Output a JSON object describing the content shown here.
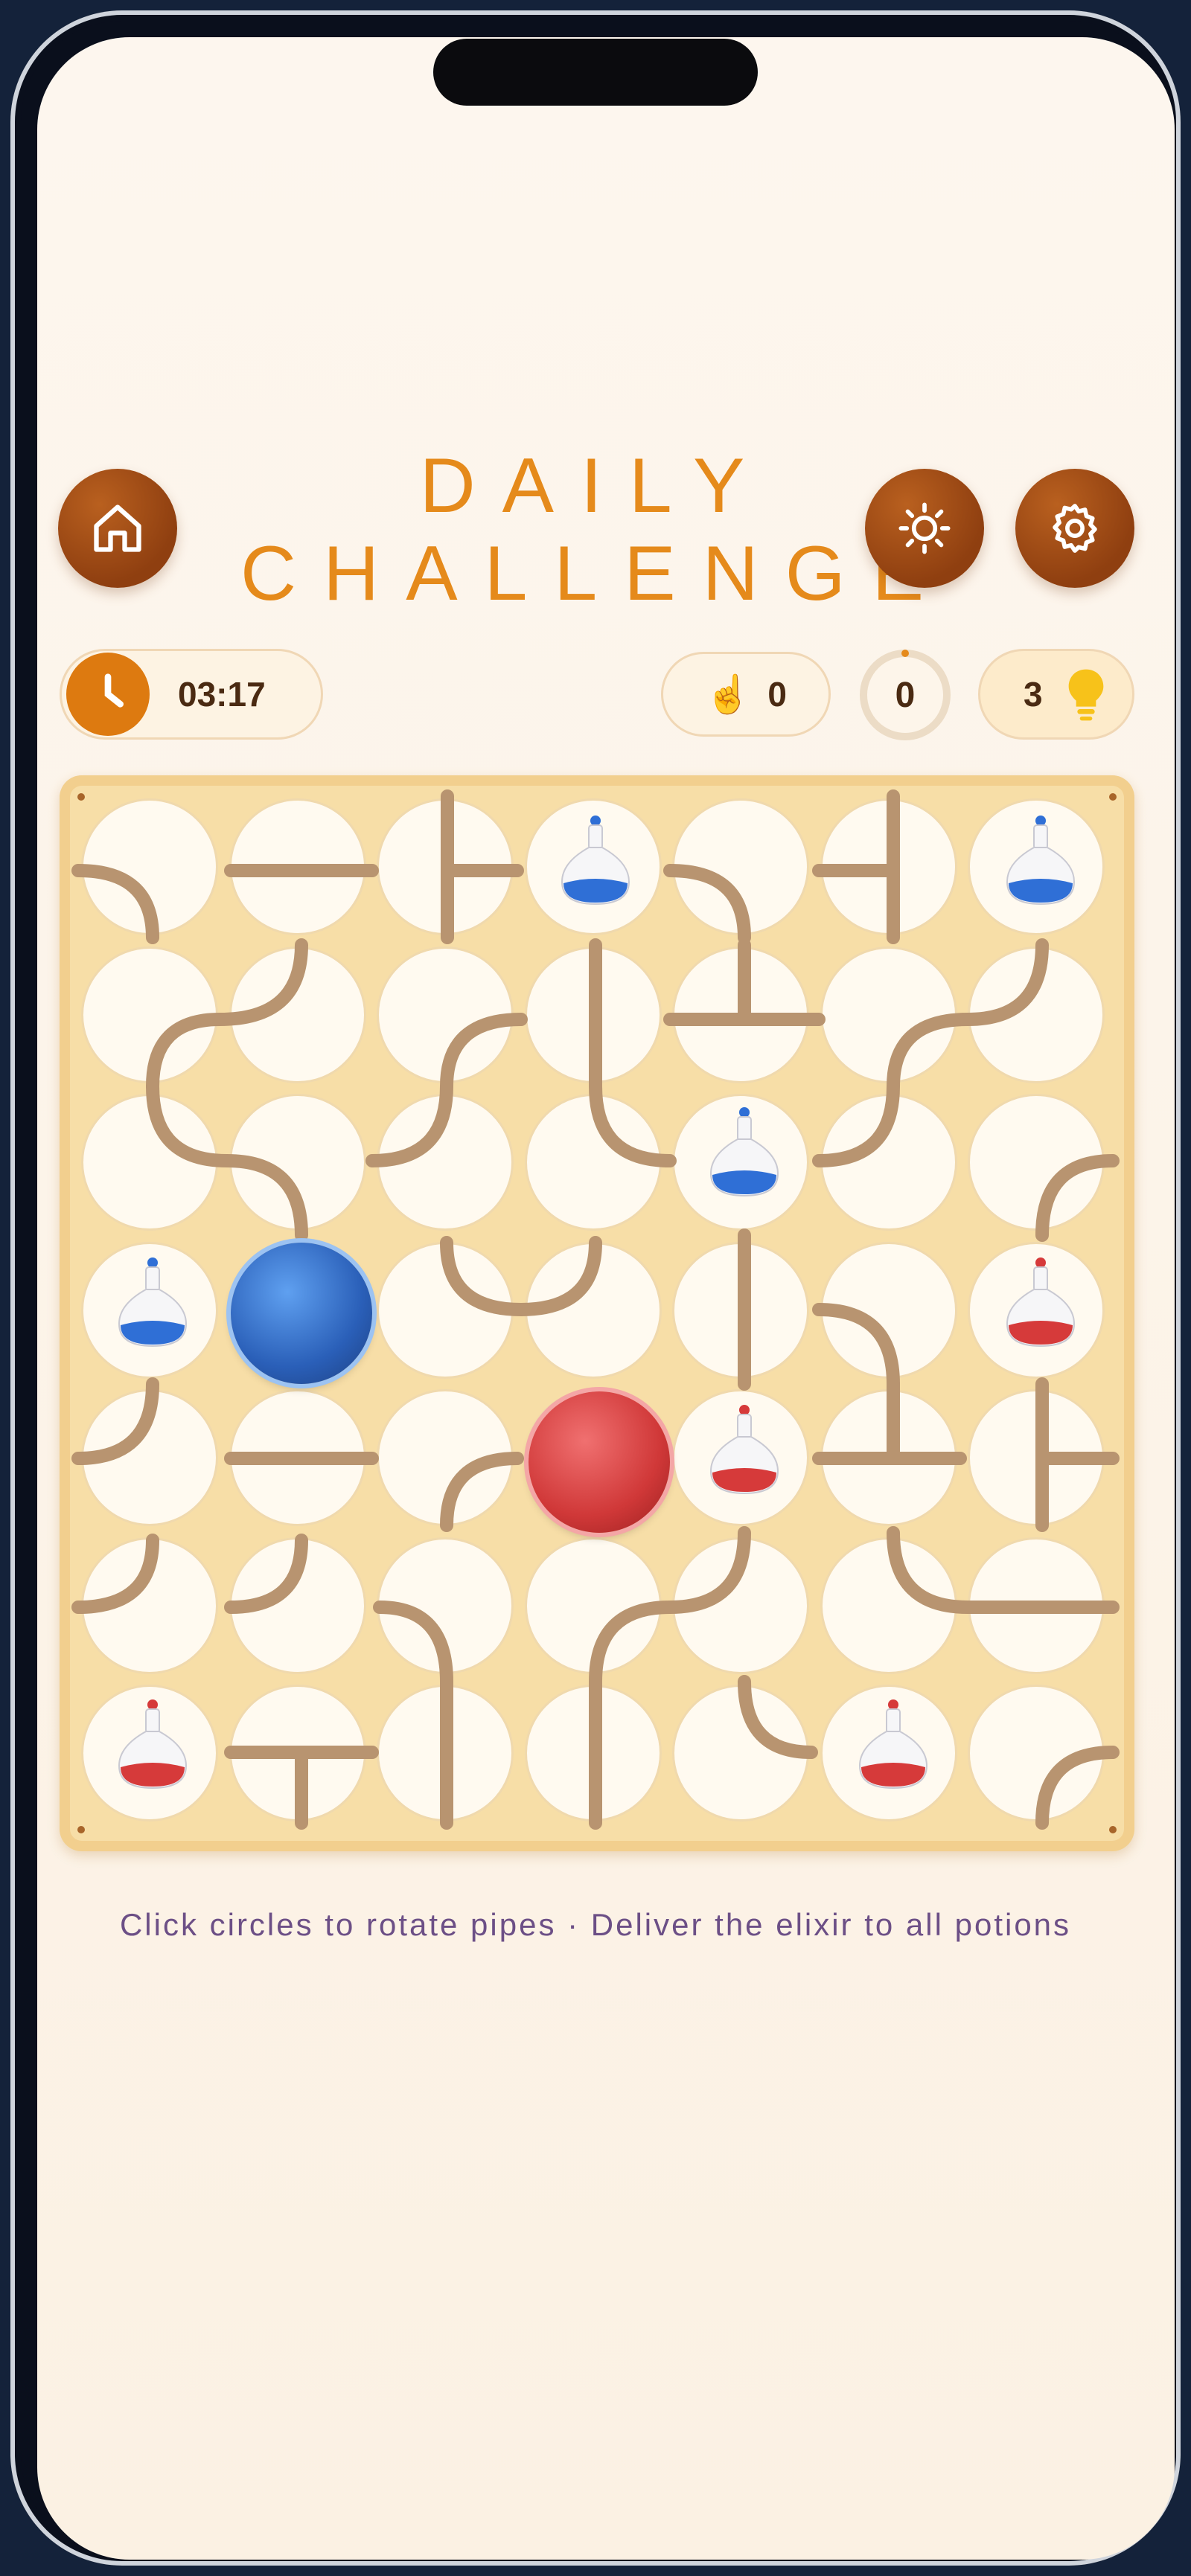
{
  "title": {
    "line1": "DAILY",
    "line2": "CHALLENGE"
  },
  "header_buttons": {
    "home": "home-icon",
    "theme": "sun-icon",
    "settings": "gear-icon"
  },
  "stats": {
    "timer": "03:17",
    "moves": "0",
    "progress": "0",
    "progress_fraction": 0,
    "hints": "3"
  },
  "board": {
    "columns": 7,
    "rows": 7
  },
  "potions": {
    "blue": "blue-potion",
    "red": "red-potion",
    "blue_color": "#2f6fd6",
    "red_color": "#d63a3a"
  },
  "instructions": "Click circles to rotate pipes · Deliver the elixir to all potions",
  "colors": {
    "accent": "#e58a1b",
    "button": "#8f3f10",
    "pipe": "#b89470",
    "board": "#f7dea7"
  }
}
